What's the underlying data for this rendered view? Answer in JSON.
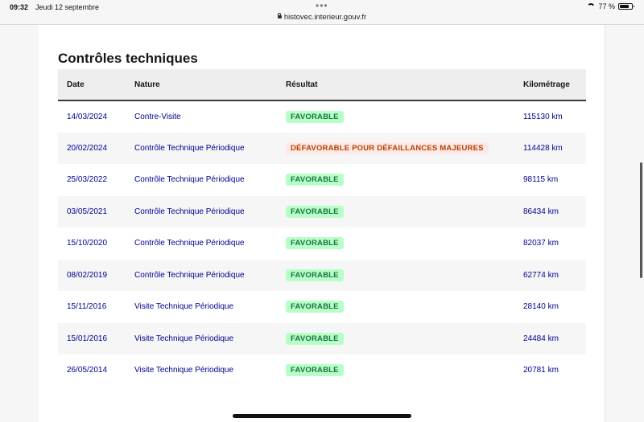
{
  "status_bar": {
    "time": "09:32",
    "date": "Jeudi 12 septembre",
    "url": "histovec.interieur.gouv.fr",
    "battery": "77 %",
    "battery_level": 0.77
  },
  "section": {
    "title": "Contrôles techniques"
  },
  "table": {
    "headers": {
      "date": "Date",
      "nature": "Nature",
      "resultat": "Résultat",
      "kilometrage": "Kilométrage"
    },
    "rows": [
      {
        "date": "14/03/2024",
        "nature": "Contre-Visite",
        "resultat": "FAVORABLE",
        "status": "ok",
        "km": "115130 km"
      },
      {
        "date": "20/02/2024",
        "nature": "Contrôle Technique Périodique",
        "resultat": "DÉFAVORABLE POUR DÉFAILLANCES MAJEURES",
        "status": "ko",
        "km": "114428 km"
      },
      {
        "date": "25/03/2022",
        "nature": "Contrôle Technique Périodique",
        "resultat": "FAVORABLE",
        "status": "ok",
        "km": "98115 km"
      },
      {
        "date": "03/05/2021",
        "nature": "Contrôle Technique Périodique",
        "resultat": "FAVORABLE",
        "status": "ok",
        "km": "86434 km"
      },
      {
        "date": "15/10/2020",
        "nature": "Contrôle Technique Périodique",
        "resultat": "FAVORABLE",
        "status": "ok",
        "km": "82037 km"
      },
      {
        "date": "08/02/2019",
        "nature": "Contrôle Technique Périodique",
        "resultat": "FAVORABLE",
        "status": "ok",
        "km": "62774 km"
      },
      {
        "date": "15/11/2016",
        "nature": "Visite Technique Périodique",
        "resultat": "FAVORABLE",
        "status": "ok",
        "km": "28140 km"
      },
      {
        "date": "15/01/2016",
        "nature": "Visite Technique Périodique",
        "resultat": "FAVORABLE",
        "status": "ok",
        "km": "24484 km"
      },
      {
        "date": "26/05/2014",
        "nature": "Visite Technique Périodique",
        "resultat": "FAVORABLE",
        "status": "ok",
        "km": "20781 km"
      }
    ]
  },
  "colors": {
    "link_text": "#000091",
    "favorable_bg": "#b8fec9",
    "favorable_text": "#18753c",
    "defavorable_bg": "#ffe9e6",
    "defavorable_text": "#b34000"
  }
}
